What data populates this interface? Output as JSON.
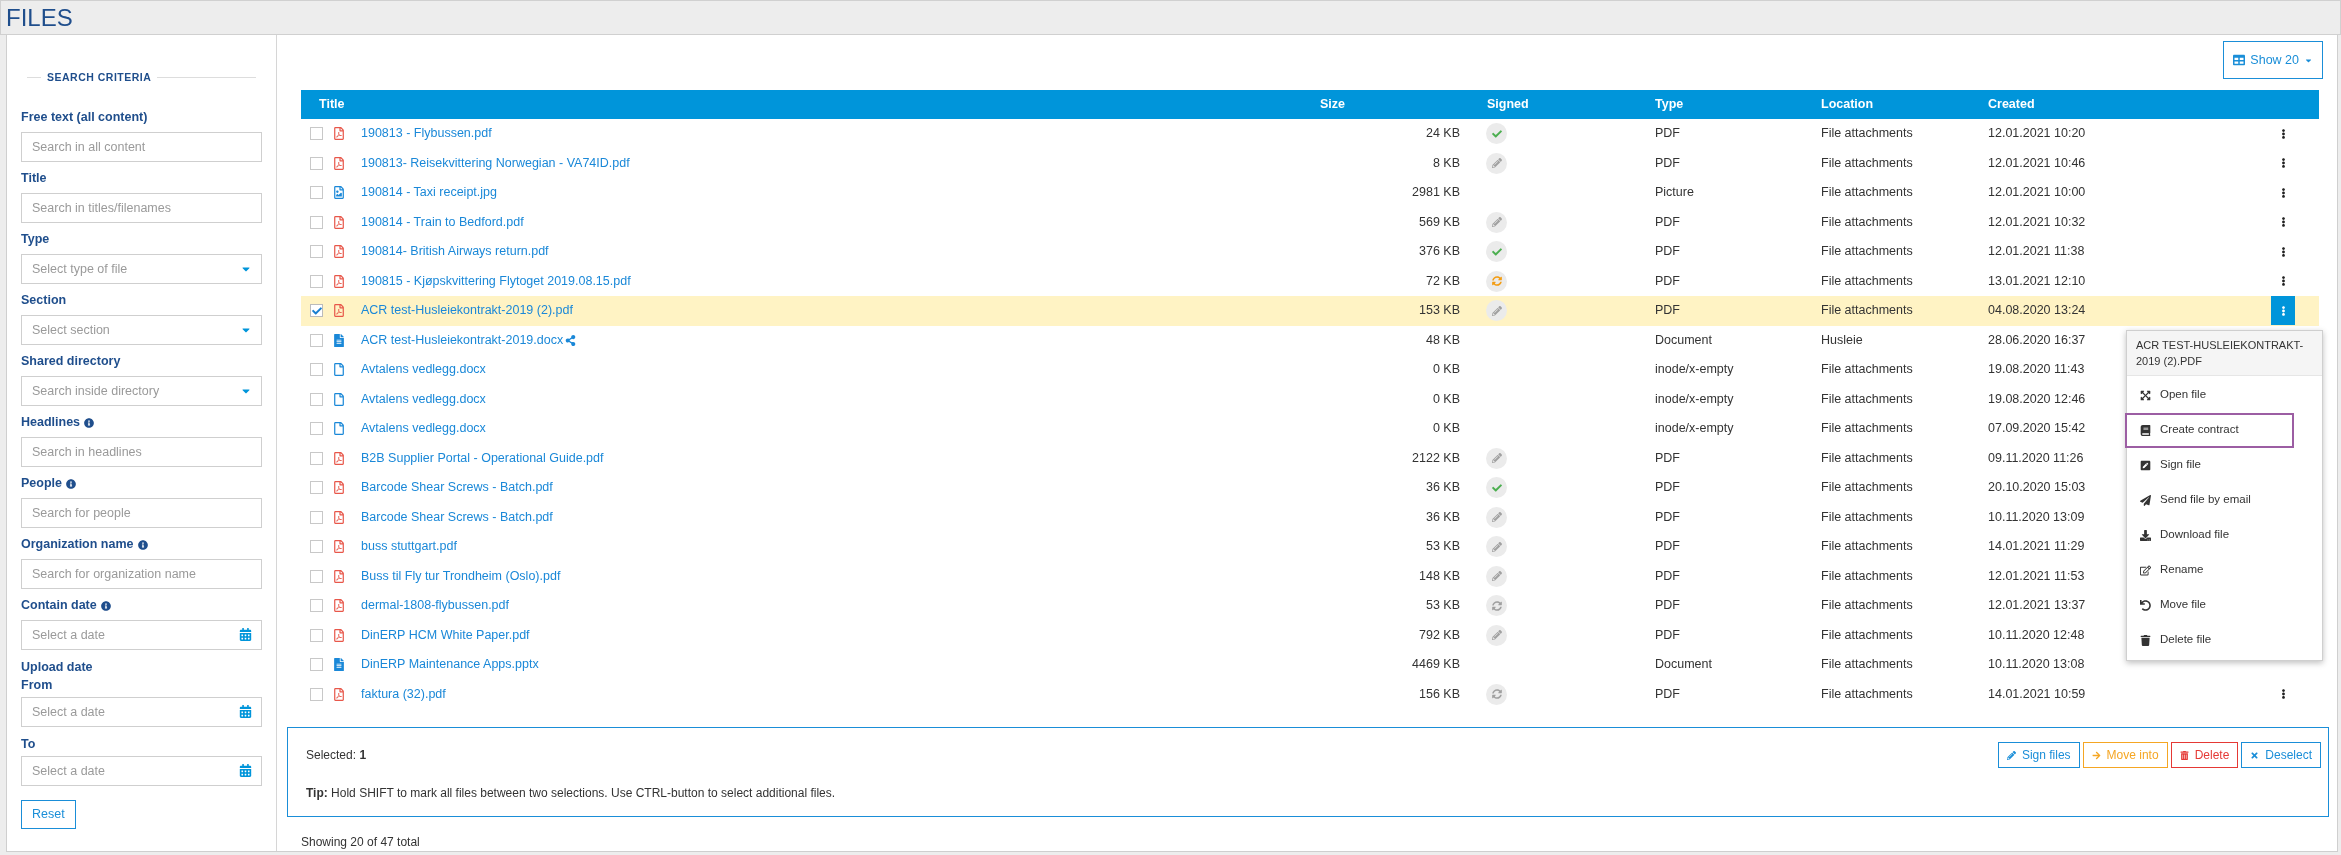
{
  "page_title": "FILES",
  "sidebar": {
    "heading": "SEARCH CRITERIA",
    "fields": [
      {
        "kind": "text",
        "label": "Free text (all content)",
        "placeholder": "Search in all content"
      },
      {
        "kind": "text",
        "label": "Title",
        "placeholder": "Search in titles/filenames"
      },
      {
        "kind": "select",
        "label": "Type",
        "placeholder": "Select type of file"
      },
      {
        "kind": "select",
        "label": "Section",
        "placeholder": "Select section"
      },
      {
        "kind": "select",
        "label": "Shared directory",
        "placeholder": "Search inside directory"
      },
      {
        "kind": "text",
        "label": "Headlines",
        "info": true,
        "placeholder": "Search in headlines"
      },
      {
        "kind": "text",
        "label": "People",
        "info": true,
        "placeholder": "Search for people"
      },
      {
        "kind": "text",
        "label": "Organization name",
        "info": true,
        "placeholder": "Search for organization name"
      },
      {
        "kind": "date",
        "label": "Contain date",
        "info": true,
        "placeholder": "Select a date"
      }
    ],
    "upload_date": {
      "label": "Upload date",
      "from_label": "From",
      "from_placeholder": "Select a date",
      "to_label": "To",
      "to_placeholder": "Select a date"
    },
    "reset_button": "Reset"
  },
  "show_button": "Show 20",
  "table": {
    "columns": [
      "Title",
      "Size",
      "Signed",
      "Type",
      "Location",
      "Created"
    ],
    "rows": [
      {
        "kind": "pdf",
        "title": "190813 - Flybussen.pdf",
        "size": "24 KB",
        "signature": {
          "kind": "done"
        },
        "type": "PDF",
        "location": "File attachments",
        "created": "12.01.2021 10:20",
        "selected": false
      },
      {
        "kind": "pdf",
        "title": "190813- Reisekvittering Norwegian - VA74ID.pdf",
        "size": "8 KB",
        "signature": {
          "kind": "draft"
        },
        "type": "PDF",
        "location": "File attachments",
        "created": "12.01.2021 10:46",
        "selected": false
      },
      {
        "kind": "image",
        "title": "190814 - Taxi receipt.jpg",
        "size": "2981 KB",
        "type": "Picture",
        "location": "File attachments",
        "created": "12.01.2021 10:00",
        "selected": false
      },
      {
        "kind": "pdf",
        "title": "190814 - Train to Bedford.pdf",
        "size": "569 KB",
        "signature": {
          "kind": "draft"
        },
        "type": "PDF",
        "location": "File attachments",
        "created": "12.01.2021 10:32",
        "selected": false
      },
      {
        "kind": "pdf",
        "title": "190814- British Airways return.pdf",
        "size": "376 KB",
        "signature": {
          "kind": "done"
        },
        "type": "PDF",
        "location": "File attachments",
        "created": "12.01.2021 11:38",
        "selected": false
      },
      {
        "kind": "pdf",
        "title": "190815 - Kjøpskvittering Flytoget 2019.08.15.pdf",
        "size": "72 KB",
        "signature": {
          "kind": "in_progress"
        },
        "type": "PDF",
        "location": "File attachments",
        "created": "13.01.2021 12:10",
        "selected": false
      },
      {
        "kind": "pdf",
        "title": "ACR test-Husleiekontrakt-2019 (2).pdf",
        "size": "153 KB",
        "signature": {
          "kind": "draft"
        },
        "type": "PDF",
        "location": "File attachments",
        "created": "04.08.2020 13:24",
        "selected": true
      },
      {
        "kind": "document",
        "title": "ACR test-Husleiekontrakt-2019.docx",
        "shared": true,
        "size": "48 KB",
        "type": "Document",
        "location": "Husleie",
        "created": "28.06.2020 16:37",
        "selected": false
      },
      {
        "kind": "blank",
        "title": "Avtalens vedlegg.docx",
        "size": "0 KB",
        "type": "inode/x-empty",
        "location": "File attachments",
        "created": "19.08.2020 11:43",
        "selected": false
      },
      {
        "kind": "blank",
        "title": "Avtalens vedlegg.docx",
        "size": "0 KB",
        "type": "inode/x-empty",
        "location": "File attachments",
        "created": "19.08.2020 12:46",
        "selected": false
      },
      {
        "kind": "blank",
        "title": "Avtalens vedlegg.docx",
        "size": "0 KB",
        "type": "inode/x-empty",
        "location": "File attachments",
        "created": "07.09.2020 15:42",
        "selected": false
      },
      {
        "kind": "pdf",
        "title": "B2B Supplier Portal - Operational Guide.pdf",
        "size": "2122 KB",
        "signature": {
          "kind": "draft"
        },
        "type": "PDF",
        "location": "File attachments",
        "created": "09.11.2020 11:26",
        "selected": false
      },
      {
        "kind": "pdf",
        "title": "Barcode Shear Screws - Batch.pdf",
        "size": "36 KB",
        "signature": {
          "kind": "done"
        },
        "type": "PDF",
        "location": "File attachments",
        "created": "20.10.2020 15:03",
        "selected": false
      },
      {
        "kind": "pdf",
        "title": "Barcode Shear Screws - Batch.pdf",
        "size": "36 KB",
        "signature": {
          "kind": "draft"
        },
        "type": "PDF",
        "location": "File attachments",
        "created": "10.11.2020 13:09",
        "selected": false
      },
      {
        "kind": "pdf",
        "title": "buss stuttgart.pdf",
        "size": "53 KB",
        "signature": {
          "kind": "draft"
        },
        "type": "PDF",
        "location": "File attachments",
        "created": "14.01.2021 11:29",
        "selected": false
      },
      {
        "kind": "pdf",
        "title": "Buss til Fly tur Trondheim (Oslo).pdf",
        "size": "148 KB",
        "signature": {
          "kind": "draft"
        },
        "type": "PDF",
        "location": "File attachments",
        "created": "12.01.2021 11:53",
        "selected": false
      },
      {
        "kind": "pdf",
        "title": "dermal-1808-flybussen.pdf",
        "size": "53 KB",
        "signature": {
          "kind": "waiting"
        },
        "type": "PDF",
        "location": "File attachments",
        "created": "12.01.2021 13:37",
        "selected": false
      },
      {
        "kind": "pdf",
        "title": "DinERP HCM White Paper.pdf",
        "size": "792 KB",
        "signature": {
          "kind": "draft"
        },
        "type": "PDF",
        "location": "File attachments",
        "created": "10.11.2020 12:48",
        "selected": false
      },
      {
        "kind": "document",
        "title": "DinERP Maintenance Apps.pptx",
        "size": "4469 KB",
        "type": "Document",
        "location": "File attachments",
        "created": "10.11.2020 13:08",
        "selected": false
      },
      {
        "kind": "pdf",
        "title": "faktura (32).pdf",
        "size": "156 KB",
        "signature": {
          "kind": "waiting"
        },
        "type": "PDF",
        "location": "File attachments",
        "created": "14.01.2021 10:59",
        "selected": false
      }
    ]
  },
  "context_menu": {
    "title": "ACR TEST-HUSLEIEKONTRAKT-2019 (2).PDF",
    "items": [
      {
        "kind": "open",
        "label": "Open file",
        "highlighted": false
      },
      {
        "kind": "contract",
        "label": "Create contract",
        "highlighted": true
      },
      {
        "kind": "sign",
        "label": "Sign file",
        "highlighted": false
      },
      {
        "kind": "email",
        "label": "Send file by email",
        "highlighted": false
      },
      {
        "kind": "download",
        "label": "Download file",
        "highlighted": false
      },
      {
        "kind": "rename",
        "label": "Rename",
        "highlighted": false
      },
      {
        "kind": "move",
        "label": "Move file",
        "highlighted": false
      },
      {
        "kind": "delete",
        "label": "Delete file",
        "highlighted": false
      }
    ]
  },
  "selection_panel": {
    "selected": "Selected: **1**",
    "tip": "**Tip:** Hold SHIFT to mark all files between two selections. Use CTRL-button to select additional files.",
    "buttons": [
      {
        "kind": "sign",
        "label": "Sign files"
      },
      {
        "kind": "move",
        "label": "Move into"
      },
      {
        "kind": "delete",
        "label": "Delete"
      },
      {
        "kind": "deselect",
        "label": "Deselect"
      }
    ]
  },
  "footer": "Showing 20 of 47 total"
}
